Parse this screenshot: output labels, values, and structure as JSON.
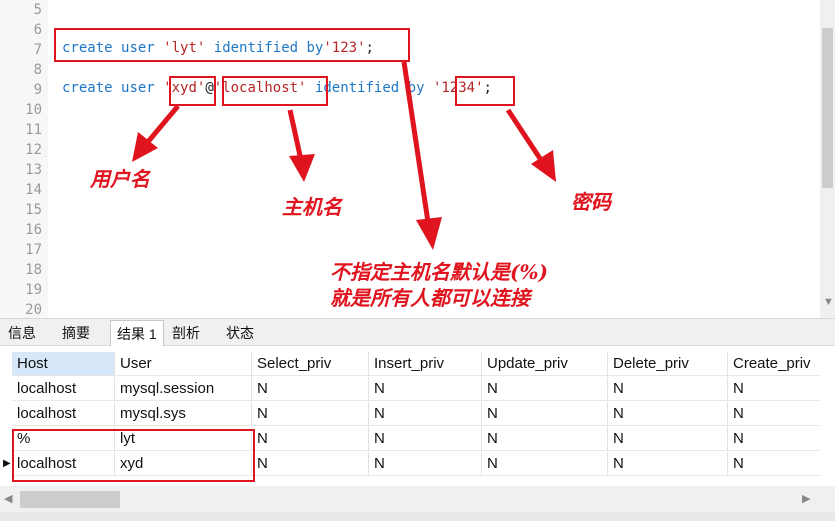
{
  "editor": {
    "line_numbers": [
      "5",
      "6",
      "7",
      "8",
      "9",
      "10",
      "11",
      "12",
      "13",
      "14",
      "15",
      "16",
      "17",
      "18",
      "19",
      "20"
    ],
    "line7": {
      "kw1": "create",
      "kw2": "user",
      "str1": "'lyt'",
      "kw3": "identified",
      "kw4": "by",
      "str2": "'123'",
      "end": ";"
    },
    "line9": {
      "kw1": "create",
      "kw2": "user",
      "str1": "'xyd'",
      "at": "@",
      "str2": "'localhost'",
      "kw3": "identified",
      "kw4": "by",
      "str3": "'1234'",
      "end": ";"
    }
  },
  "annotations": {
    "username": "用户名",
    "hostname": "主机名",
    "password": "密码",
    "note_line1": "不指定主机名默认是(%)",
    "note_line2": "就是所有人都可以连接"
  },
  "tabs": [
    "信息",
    "摘要",
    "结果 1",
    "剖析",
    "状态"
  ],
  "active_tab": "结果 1",
  "grid": {
    "columns": [
      "Host",
      "User",
      "Select_priv",
      "Insert_priv",
      "Update_priv",
      "Delete_priv",
      "Create_priv"
    ],
    "rows": [
      [
        "localhost",
        "mysql.session",
        "N",
        "N",
        "N",
        "N",
        "N"
      ],
      [
        "localhost",
        "mysql.sys",
        "N",
        "N",
        "N",
        "N",
        "N"
      ],
      [
        "%",
        "lyt",
        "N",
        "N",
        "N",
        "N",
        "N"
      ],
      [
        "localhost",
        "xyd",
        "N",
        "N",
        "N",
        "N",
        "N"
      ]
    ]
  },
  "colors": {
    "annotation": "#e0141e",
    "keyword": "#1e77c8",
    "string": "#b52525"
  }
}
